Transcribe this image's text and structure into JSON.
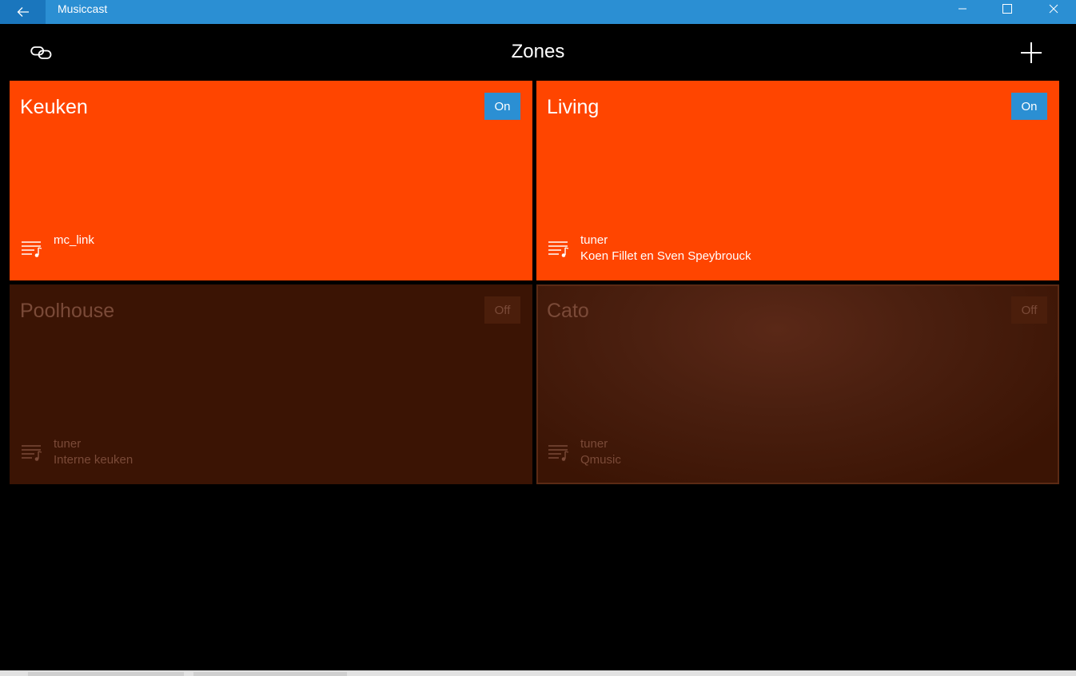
{
  "window": {
    "title": "Musiccast"
  },
  "header": {
    "title": "Zones"
  },
  "zones": [
    {
      "name": "Keuken",
      "power": "On",
      "source": "mc_link",
      "detail": ""
    },
    {
      "name": "Living",
      "power": "On",
      "source": "tuner",
      "detail": "Koen Fillet en Sven Speybrouck"
    },
    {
      "name": "Poolhouse",
      "power": "Off",
      "source": "tuner",
      "detail": "Interne keuken"
    },
    {
      "name": "Cato",
      "power": "Off",
      "source": "tuner",
      "detail": "Qmusic"
    }
  ],
  "colors": {
    "titlebar": "#2b8fd3",
    "zone_on": "#ff4500",
    "zone_off": "#3b1404",
    "power_on_button": "#2b8fd3"
  },
  "icons": {
    "back": "arrow-left-icon",
    "link": "link-icon",
    "add": "plus-icon",
    "source": "playlist-music-icon",
    "minimize": "minimize-icon",
    "maximize": "maximize-icon",
    "close": "close-icon"
  }
}
